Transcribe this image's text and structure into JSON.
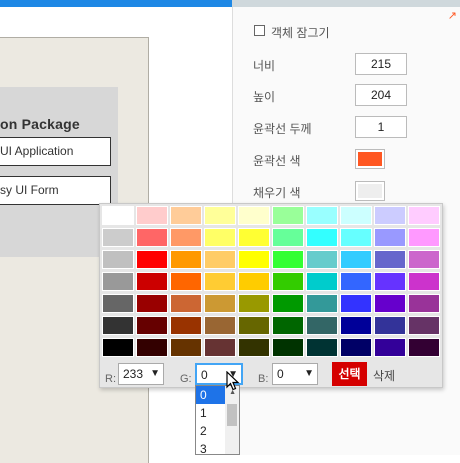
{
  "canvas": {
    "package_title": "on Package",
    "items": [
      "UI Application",
      "sy UI Form"
    ]
  },
  "properties": {
    "lock_label": "객체 잠그기",
    "lock_checked": false,
    "width_label": "너비",
    "width_value": "215",
    "height_label": "높이",
    "height_value": "204",
    "border_width_label": "윤곽선 두께",
    "border_width_value": "1",
    "border_color_label": "윤곽선 색",
    "border_color": "#ff5722",
    "fill_color_label": "채우기 색",
    "fill_color": "#eeeeee"
  },
  "color_picker": {
    "palette": [
      [
        "#ffffff",
        "#ffcccc",
        "#ffcc99",
        "#ffff99",
        "#ffffcc",
        "#99ff99",
        "#99ffff",
        "#ccffff",
        "#ccccff",
        "#ffccff"
      ],
      [
        "#cccccc",
        "#ff6666",
        "#ff9966",
        "#ffff66",
        "#ffff33",
        "#66ff99",
        "#33ffff",
        "#66ffff",
        "#9999ff",
        "#ff99ff"
      ],
      [
        "#c0c0c0",
        "#ff0000",
        "#ff9900",
        "#ffcc66",
        "#ffff00",
        "#33ff33",
        "#66cccc",
        "#33ccff",
        "#6666cc",
        "#cc66cc"
      ],
      [
        "#999999",
        "#cc0000",
        "#ff6600",
        "#ffcc33",
        "#ffcc00",
        "#33cc00",
        "#00cccc",
        "#3366ff",
        "#6633ff",
        "#cc33cc"
      ],
      [
        "#666666",
        "#990000",
        "#cc6633",
        "#cc9933",
        "#999900",
        "#009900",
        "#339999",
        "#3333ff",
        "#6600cc",
        "#993399"
      ],
      [
        "#333333",
        "#660000",
        "#993300",
        "#996633",
        "#666600",
        "#006600",
        "#336666",
        "#000099",
        "#333399",
        "#663366"
      ],
      [
        "#000000",
        "#330000",
        "#663300",
        "#663333",
        "#333300",
        "#003300",
        "#003333",
        "#000066",
        "#330099",
        "#330033"
      ]
    ],
    "r_label": "R:",
    "r_value": "233",
    "g_label": "G:",
    "g_value": "0",
    "b_label": "B:",
    "b_value": "0",
    "select_button": "선택",
    "delete_button": "삭제",
    "g_dropdown_options": [
      "0",
      "1",
      "2",
      "3"
    ],
    "g_dropdown_selected": "0"
  }
}
